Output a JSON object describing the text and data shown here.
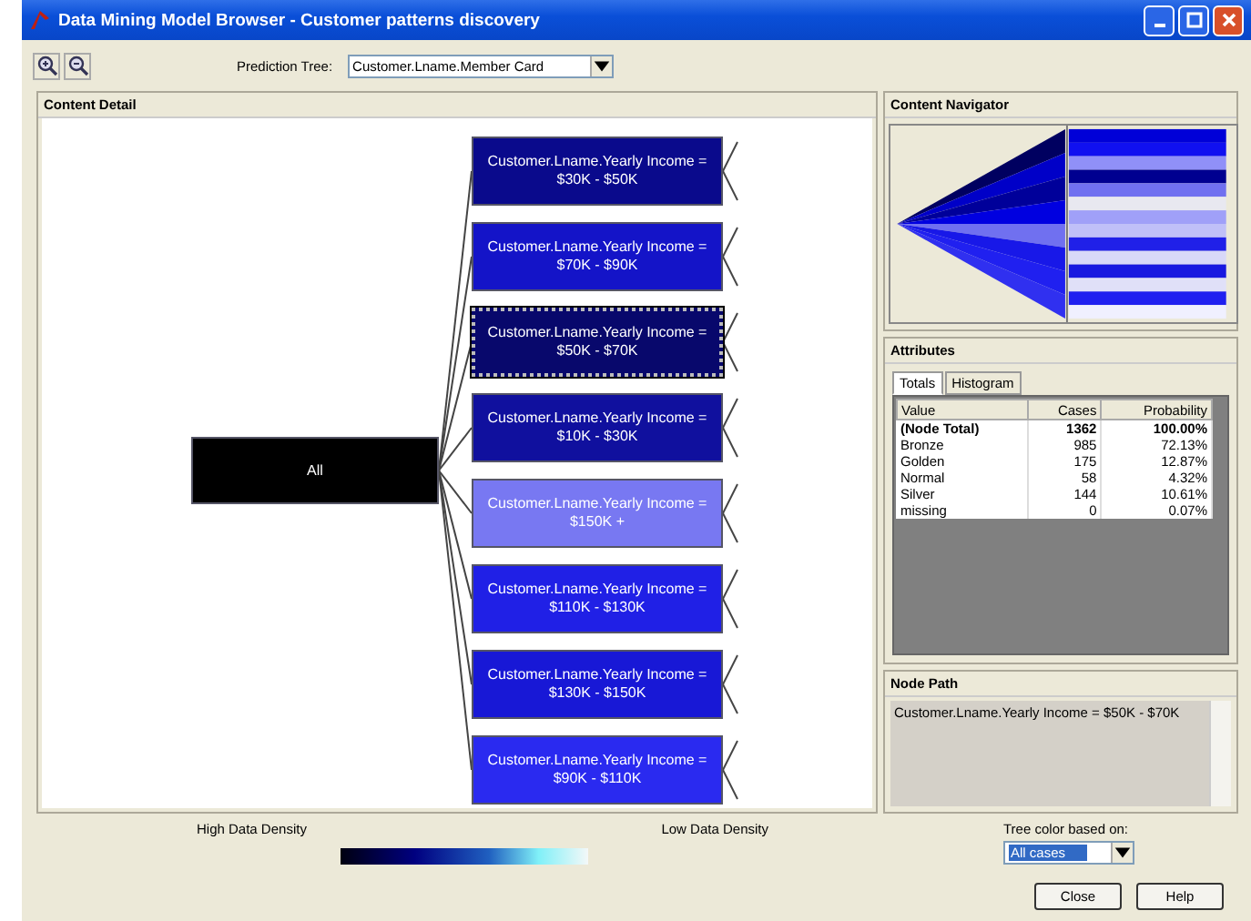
{
  "window": {
    "title": "Data Mining Model Browser - Customer patterns discovery"
  },
  "toolbar": {
    "prediction_tree_label": "Prediction Tree:",
    "prediction_tree_value": "Customer.Lname.Member Card"
  },
  "content_detail": {
    "title": "Content Detail",
    "root": {
      "label": "All",
      "color": "#000000"
    },
    "children": [
      {
        "label": "Customer.Lname.Yearly Income =\n$30K - $50K",
        "color": "#0a0a8c",
        "selected": false
      },
      {
        "label": "Customer.Lname.Yearly Income =\n$70K - $90K",
        "color": "#1414c8",
        "selected": false
      },
      {
        "label": "Customer.Lname.Yearly Income =\n$50K - $70K",
        "color": "#08086c",
        "selected": true
      },
      {
        "label": "Customer.Lname.Yearly Income =\n$10K - $30K",
        "color": "#10109e",
        "selected": false
      },
      {
        "label": "Customer.Lname.Yearly Income =\n$150K +",
        "color": "#7878f2",
        "selected": false
      },
      {
        "label": "Customer.Lname.Yearly Income =\n$110K - $130K",
        "color": "#2020e6",
        "selected": false
      },
      {
        "label": "Customer.Lname.Yearly Income =\n$130K - $150K",
        "color": "#1818d6",
        "selected": false
      },
      {
        "label": "Customer.Lname.Yearly Income =\n$90K - $110K",
        "color": "#2a2af0",
        "selected": false
      }
    ]
  },
  "content_navigator": {
    "title": "Content Navigator"
  },
  "attributes": {
    "title": "Attributes",
    "tabs": [
      {
        "label": "Totals",
        "selected": true
      },
      {
        "label": "Histogram",
        "selected": false
      }
    ],
    "columns": [
      "Value",
      "Cases",
      "Probability"
    ],
    "rows": [
      {
        "kind": "total",
        "value": "(Node Total)",
        "cases": "1362",
        "probability": "100.00%"
      },
      {
        "kind": "item",
        "value": "Bronze",
        "cases": "985",
        "probability": "72.13%"
      },
      {
        "kind": "item",
        "value": "Golden",
        "cases": "175",
        "probability": "12.87%"
      },
      {
        "kind": "item",
        "value": "Normal",
        "cases": "58",
        "probability": "4.32%"
      },
      {
        "kind": "item",
        "value": "Silver",
        "cases": "144",
        "probability": "10.61%"
      },
      {
        "kind": "item",
        "value": "missing",
        "cases": "0",
        "probability": "0.07%"
      }
    ]
  },
  "node_path": {
    "title": "Node Path",
    "text": "Customer.Lname.Yearly Income = $50K - $70K"
  },
  "legend": {
    "high_label": "High Data Density",
    "low_label": "Low Data Density"
  },
  "tree_color": {
    "label": "Tree color based on:",
    "value": "All cases"
  },
  "buttons": [
    "Close",
    "Help"
  ]
}
